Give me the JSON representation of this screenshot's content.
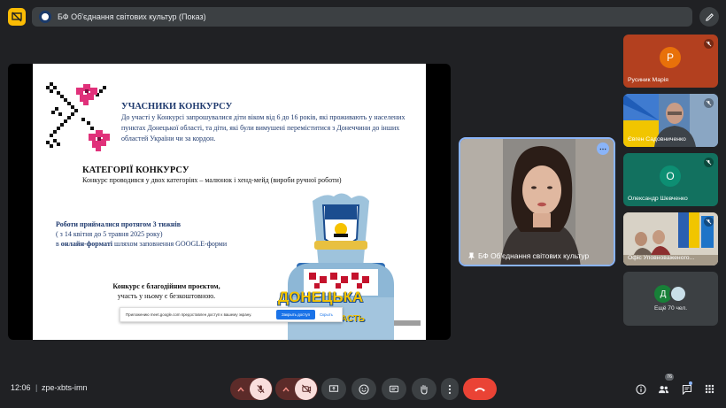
{
  "top_bar": {
    "meeting_title": "БФ Об'єднання світових культур (Показ)"
  },
  "slide": {
    "participants_heading": "УЧАСНИКИ КОНКУРСУ",
    "participants_text": "До участі у Конкурсі запрошувалися діти віком від 6 до 16 років, які проживають у населених пунктах Донецької області, та діти, які були вимушені переміститися з Донеччини до інших областей України чи за кордон.",
    "categories_heading": "КАТЕГОРІЇ КОНКУРСУ",
    "categories_text": "Конкурс проводився у двох категоріях – малюнок і хенд-мейд (вироби ручної роботи)",
    "time_line1": "Роботи приймалися протягом 3 тижнів",
    "time_line2": "( з 14 квітня до 5 травня 2025 року)",
    "time_line3_prefix": "в ",
    "time_line3_bold": "онлайн-форматі",
    "time_line3_suffix": " шляхом заповнення GOOGLE-форми",
    "charity_line1": "Конкурс є благодійним проєктом,",
    "charity_line2": "участь у ньому є безкоштовною.",
    "monument_label": "ДОНЕЦЬКА",
    "monument_sub": "ОБЛАСТЬ",
    "share_text": "Приложению meet.google.com предоставлен доступ к вашему экрану.",
    "share_button": "Закрыть доступ",
    "share_hide": "Скрыть"
  },
  "speaker": {
    "name": "БФ Об'єднання світових культур"
  },
  "participants": [
    {
      "name": "Русиник Марія",
      "letter": "Р",
      "bg": "#b3401f",
      "avatar": "#e8710a"
    },
    {
      "name": "Євген Садовниченко",
      "letter": "",
      "bg": "#6a8fb8",
      "avatar": ""
    },
    {
      "name": "Олександр Шевченко",
      "letter": "О",
      "bg": "#12715f",
      "avatar": "#0d8f73"
    },
    {
      "name": "Офіс Уповноваженого...",
      "letter": "",
      "bg": "#b9a98b",
      "avatar": ""
    }
  ],
  "more": {
    "letter": "Д",
    "text": "Ещё 70 чел."
  },
  "bottom_bar": {
    "time": "12:06",
    "meeting_code": "zpe-xbts-imn",
    "participants_count": "76"
  },
  "colors": {
    "background": "#202124",
    "accent": "#8ab4f8",
    "end_call": "#ea4335",
    "present_icon": "#fbbc04"
  },
  "icons": [
    "present-icon",
    "pen-icon",
    "mic-off-icon",
    "camera-off-icon",
    "present-screen-icon",
    "emoji-icon",
    "captions-icon",
    "raise-hand-icon",
    "more-vert-icon",
    "end-call-icon",
    "info-icon",
    "people-icon",
    "chat-icon",
    "activities-icon"
  ]
}
